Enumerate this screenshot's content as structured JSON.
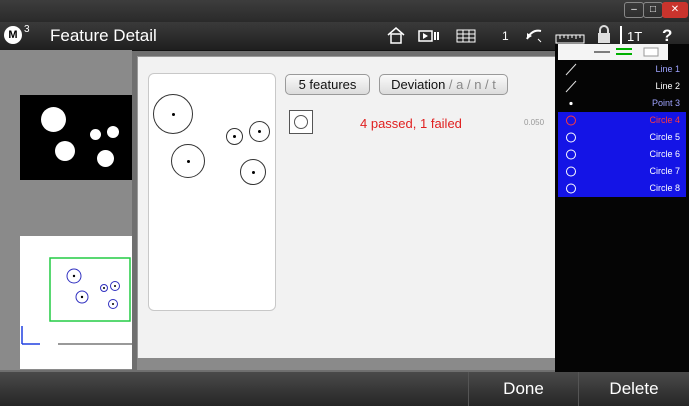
{
  "window": {
    "title": "Feature Detail",
    "logo_letter": "M",
    "logo_superscript": "3"
  },
  "toolbar": {
    "counter": "1",
    "mode": "1T",
    "help": "?"
  },
  "dialog": {
    "features_button": "5 features",
    "deviation_button": {
      "label": "Deviation",
      "suffix": " / a / n / t"
    },
    "status_text": "4 passed, 1 failed",
    "tolerance": "0.050"
  },
  "feature_list": {
    "items": [
      {
        "icon": "line-icon",
        "name": "Line 1",
        "state": "normal",
        "color": "#9fa4ff"
      },
      {
        "icon": "line-icon",
        "name": "Line 2",
        "state": "normal",
        "color": "#ffffff"
      },
      {
        "icon": "point-icon",
        "name": "Point 3",
        "state": "normal",
        "color": "#9fa4ff"
      },
      {
        "icon": "circle-icon",
        "name": "Circle 4",
        "state": "failed",
        "color": "#ff3b3b"
      },
      {
        "icon": "circle-icon",
        "name": "Circle 5",
        "state": "selected",
        "color": "#ffffff"
      },
      {
        "icon": "circle-icon",
        "name": "Circle 6",
        "state": "selected",
        "color": "#ffffff"
      },
      {
        "icon": "circle-icon",
        "name": "Circle 7",
        "state": "selected",
        "color": "#ffffff"
      },
      {
        "icon": "circle-icon",
        "name": "Circle 8",
        "state": "selected",
        "color": "#ffffff"
      }
    ]
  },
  "bottom": {
    "done": "Done",
    "delete": "Delete"
  },
  "colors": {
    "selected_row": "#1414e6",
    "failed": "#ff3b3b",
    "accent": "#00b000"
  }
}
